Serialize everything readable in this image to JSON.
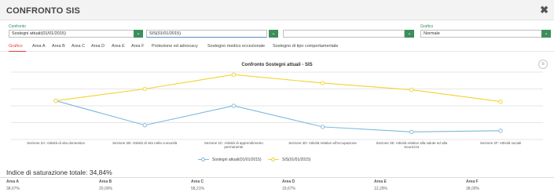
{
  "header": {
    "title": "CONFRONTO SIS",
    "close_icon": "close-icon"
  },
  "filters": {
    "confronto_label": "Confronto",
    "select1_value": "Sostegni attuali(01/01/2015)",
    "select2_value": "SIS(01/01/2015)",
    "select3_value": "",
    "grafico_label": "Grafico",
    "grafico_value": "Normale"
  },
  "tabs": [
    "Grafico",
    "Area A",
    "Area B",
    "Area C",
    "Area D",
    "Area E",
    "Area F",
    "Protezione ed advocacy",
    "Sostegno medico eccezionale",
    "Sostegno di tipo comportamentale"
  ],
  "chart_data": {
    "type": "line",
    "title": "Confronto Sostegni attuali - SIS",
    "categories": [
      "Sezione 2A: Attività di vita domestica",
      "Sezione 2B: Attività di vita nella comunità",
      "Sezione 2C: Attività di apprendimento permanente",
      "Sezione 2D: Attività relative all'occupazione",
      "Sezione 2E: Attività relative alla salute ed alla sicurezza",
      "Sezione 2F: Attività sociali"
    ],
    "series": [
      {
        "name": "Sostegni attuali(01/01/2015)",
        "color": "#7cb9dc",
        "values": [
          2.3,
          0.85,
          2.0,
          0.75,
          0.45,
          0.52
        ]
      },
      {
        "name": "SIS(01/01/2015)",
        "color": "#f2d230",
        "values": [
          2.3,
          3.0,
          3.85,
          3.35,
          2.95,
          2.25
        ]
      }
    ],
    "ylim": [
      0,
      4
    ],
    "grid": true,
    "legend": "bottom"
  },
  "summary": {
    "index_label": "Indice di saturazione totale: 34,84%",
    "headers": [
      "Area A",
      "Area B",
      "Area C",
      "Area D",
      "Area E",
      "Area F"
    ],
    "values": [
      "38,67%",
      "20,00%",
      "58,21%",
      "19,67%",
      "12,29%",
      "38,00%"
    ]
  }
}
